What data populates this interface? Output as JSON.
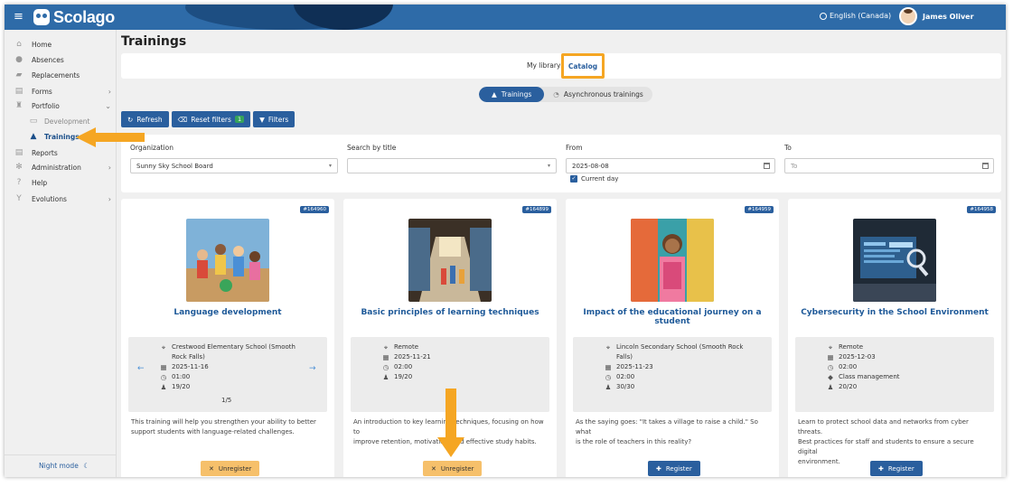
{
  "app": {
    "logo_text": "Scolago",
    "language": "English (Canada)",
    "user_name": "James Oliver"
  },
  "sidebar": {
    "items": [
      {
        "label": "Home",
        "icon": "home-icon"
      },
      {
        "label": "Absences",
        "icon": "person-icon"
      },
      {
        "label": "Replacements",
        "icon": "eraser-icon"
      },
      {
        "label": "Forms",
        "icon": "form-icon"
      },
      {
        "label": "Portfolio",
        "icon": "trophy-icon"
      },
      {
        "label": "Development",
        "icon": "certificate-icon"
      },
      {
        "label": "Trainings",
        "icon": "graduation-cap-icon"
      },
      {
        "label": "Reports",
        "icon": "document-icon"
      },
      {
        "label": "Administration",
        "icon": "gear-icon"
      },
      {
        "label": "Help",
        "icon": "question-icon"
      },
      {
        "label": "Evolutions",
        "icon": "branch-icon"
      }
    ],
    "night_mode": "Night mode"
  },
  "page": {
    "title": "Trainings"
  },
  "tabs": {
    "my_library": "My library",
    "catalog": "Catalog"
  },
  "segment": {
    "trainings": "Trainings",
    "async": "Asynchronous trainings"
  },
  "actions": {
    "refresh": "Refresh",
    "reset_filters": "Reset filters",
    "reset_count": "1",
    "filters": "Filters"
  },
  "filters": {
    "organization_label": "Organization",
    "organization_value": "Sunny Sky School Board",
    "search_label": "Search by title",
    "from_label": "From",
    "from_value": "2025-08-08",
    "current_day": "Current day",
    "to_label": "To",
    "to_placeholder": "To"
  },
  "cards": [
    {
      "id": "#164960",
      "title": "Language development",
      "location": [
        "Crestwood Elementary School (Smooth",
        "Rock Falls)"
      ],
      "date": "2025-11-16",
      "duration": "01:00",
      "seats": "19/20",
      "pager": "1/5",
      "description": [
        "This training will help you strengthen your ability to better",
        "support students with language-related challenges."
      ],
      "action": "Unregister"
    },
    {
      "id": "#164899",
      "title": "Basic principles of learning techniques",
      "location": [
        "Remote"
      ],
      "date": "2025-11-21",
      "duration": "02:00",
      "seats": "19/20",
      "description": [
        "An introduction to key learning techniques, focusing on how to",
        "improve retention, motivation, and effective study habits."
      ],
      "action": "Unregister"
    },
    {
      "id": "#164959",
      "title": "Impact of the educational journey on a student",
      "location": [
        "Lincoln Secondary School (Smooth Rock",
        "Falls)"
      ],
      "date": "2025-11-23",
      "duration": "02:00",
      "seats": "30/30",
      "description": [
        "As the saying goes: \"It takes a village to raise a child.\" So what",
        "is the role of teachers in this reality?"
      ],
      "action": "Register"
    },
    {
      "id": "#164958",
      "title": "Cybersecurity in the School Environment",
      "location": [
        "Remote"
      ],
      "date": "2025-12-03",
      "duration": "02:00",
      "category": "Class management",
      "seats": "20/20",
      "description": [
        "Learn to protect school data and networks from cyber threats.",
        "Best practices for staff and students to ensure a secure digital",
        "environment."
      ],
      "action": "Register"
    }
  ],
  "colors": {
    "primary": "#2a5f9e",
    "highlight": "#f5a623",
    "unregister": "#f6c06b",
    "topbar": "#2e6ba8"
  }
}
